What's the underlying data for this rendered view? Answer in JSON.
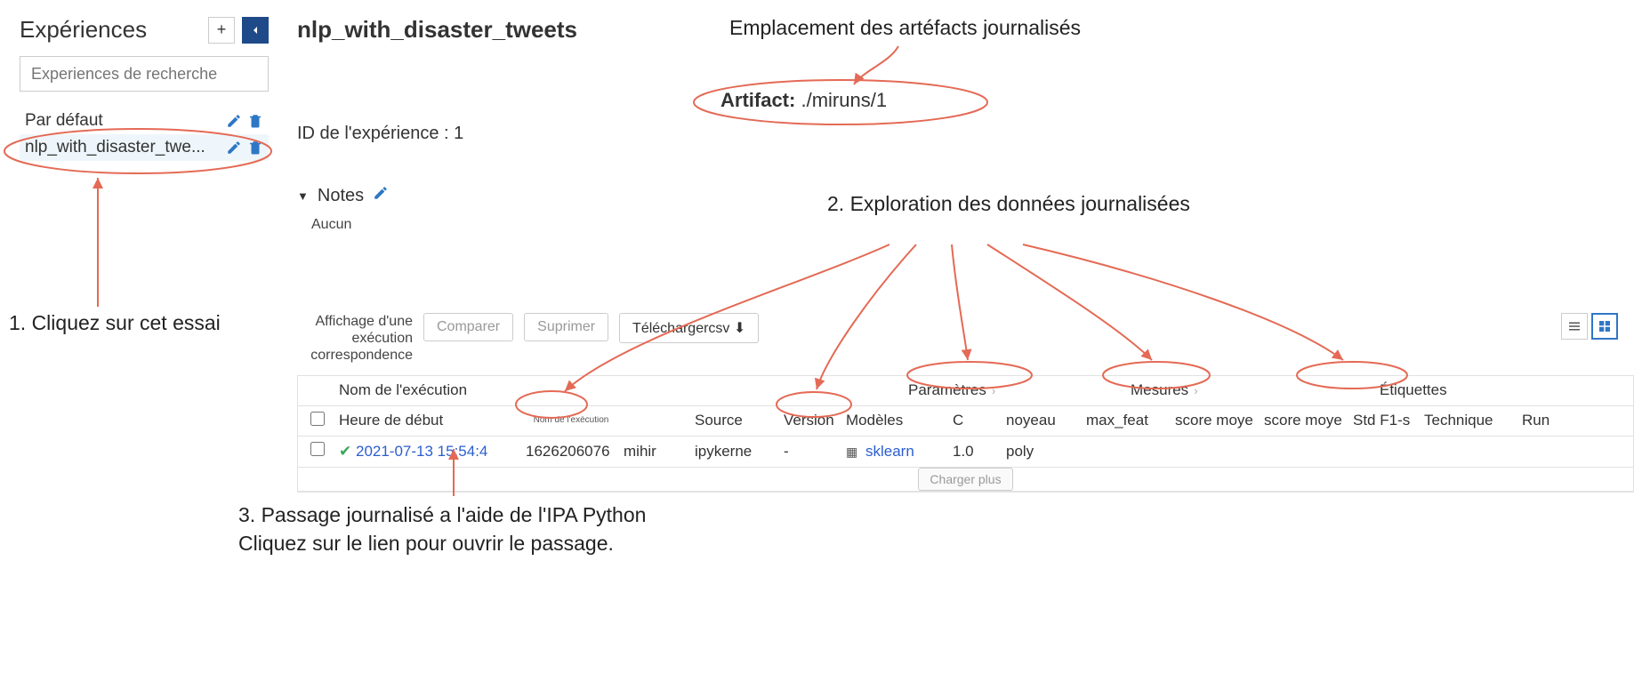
{
  "sidebar": {
    "title": "Expériences",
    "search_placeholder": "Experiences de recherche",
    "items": [
      {
        "name": "Par défaut"
      },
      {
        "name": "nlp_with_disaster_twe..."
      }
    ]
  },
  "main": {
    "title": "nlp_with_disaster_tweets",
    "experiment_id_label": "ID de l'expérience : 1",
    "notes_label": "Notes",
    "notes_body": "Aucun",
    "artifact_label": "Artifact:",
    "artifact_path": "./miruns/1",
    "showing_text": "Affichage d'une exécution correspondence",
    "buttons": {
      "compare": "Comparer",
      "delete": "Suprimer",
      "download": "Téléchargercsv"
    },
    "load_more": "Charger plus"
  },
  "table": {
    "group_headers": {
      "run_name": "Nom de l'exécution",
      "parameters": "Paramètres",
      "metrics": "Mesures",
      "tags": "Étiquettes"
    },
    "columns": {
      "start_time": "Heure de début",
      "run_name_small": "Nom de l'exécution",
      "user": "",
      "source": "Source",
      "version": "Version",
      "models": "Modèles",
      "c": "C",
      "kernel": "noyeau",
      "max_feat": "max_feat",
      "score_moy1": "score moye",
      "score_moy2": "score moye",
      "std_f1": "Std F1-s",
      "technique": "Technique",
      "run": "Run"
    },
    "rows": [
      {
        "start_time": "2021-07-13 15:54:4",
        "run_name": "1626206076",
        "user": "mihir",
        "source": "ipykerne",
        "version": "-",
        "models": "sklearn",
        "c": "1.0",
        "kernel": "poly",
        "max_feat": "",
        "score_moy1": "",
        "score_moy2": "",
        "std_f1": "",
        "technique": "",
        "run": ""
      }
    ]
  },
  "annotations": {
    "a1": "1. Cliquez sur cet essai",
    "a2": "2. Exploration des données journalisées",
    "a3_line1": "3. Passage journalisé a l'aide de l'IPA Python",
    "a3_line2": "Cliquez sur le lien pour ouvrir le passage.",
    "artifact_loc": "Emplacement des artéfacts journalisés"
  }
}
